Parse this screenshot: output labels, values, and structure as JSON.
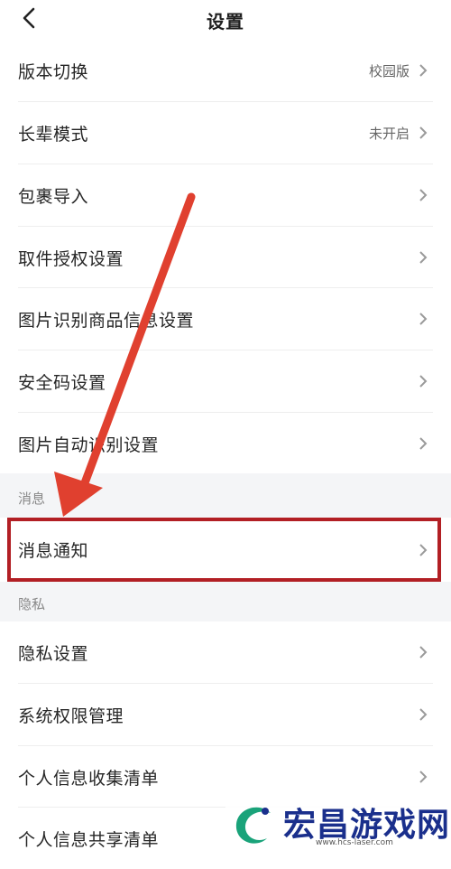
{
  "header": {
    "title": "设置"
  },
  "rows": [
    {
      "label": "版本切换",
      "value": "校园版"
    },
    {
      "label": "长辈模式",
      "value": "未开启"
    },
    {
      "label": "包裹导入",
      "value": ""
    },
    {
      "label": "取件授权设置",
      "value": ""
    },
    {
      "label": "图片识别商品信息设置",
      "value": ""
    },
    {
      "label": "安全码设置",
      "value": ""
    },
    {
      "label": "图片自动识别设置",
      "value": ""
    }
  ],
  "sections": {
    "messages": {
      "title": "消息",
      "items": [
        {
          "label": "消息通知"
        }
      ]
    },
    "privacy": {
      "title": "隐私",
      "items": [
        {
          "label": "隐私设置"
        },
        {
          "label": "系统权限管理"
        },
        {
          "label": "个人信息收集清单"
        },
        {
          "label": "个人信息共享清单"
        }
      ]
    }
  },
  "annotation": {
    "highlight_color": "#b21f24",
    "arrow_color": "#e0402f"
  },
  "watermark": {
    "brand": "宏昌游戏网",
    "url": "www.hcs-laser.com"
  }
}
